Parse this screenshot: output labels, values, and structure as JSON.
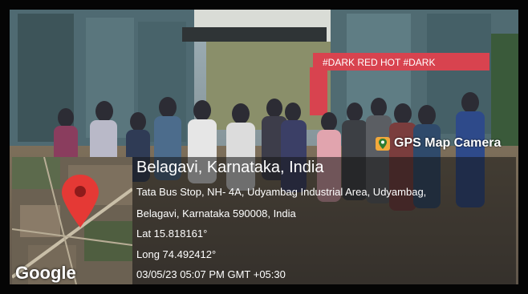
{
  "badge": {
    "label": "GPS Map Camera",
    "icon": "gps-camera-icon"
  },
  "signage": {
    "text": "#DARK   RED   HOT   #DARK"
  },
  "map": {
    "logo_text": "Google",
    "pin_icon": "location-pin-icon"
  },
  "location": {
    "city": "Belagavi, Karnataka, India",
    "address_line1": "Tata Bus Stop, NH- 4A, Udyambag Industrial Area, Udyambag,",
    "address_line2": "Belagavi, Karnataka 590008, India",
    "lat": "Lat 15.818161°",
    "long": "Long 74.492412°",
    "timestamp": "03/05/23 05:07 PM GMT +05:30"
  },
  "colors": {
    "pin": "#e53935",
    "signage_bg": "#d8434f"
  }
}
